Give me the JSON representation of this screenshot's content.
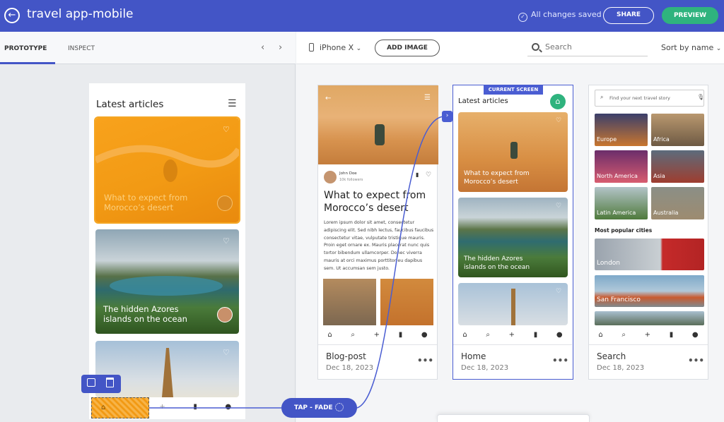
{
  "header": {
    "back_icon": "arrow-left-circle-icon",
    "title": "travel app-mobile",
    "status": "All changes saved",
    "share_label": "SHARE",
    "preview_label": "PREVIEW",
    "brand_color": "#4355c6",
    "preview_color": "#2fb37e"
  },
  "left_tabs": {
    "prototype": "PROTOTYPE",
    "inspect": "INSPECT",
    "prev": "‹",
    "next": "›"
  },
  "toolbar": {
    "device": "iPhone X",
    "add_image": "ADD IMAGE",
    "search_placeholder": "Search",
    "sort": "Sort by name"
  },
  "editor": {
    "title": "Latest articles",
    "cards": [
      {
        "text": "What to expect from Morocco’s desert"
      },
      {
        "text": "The hidden Azores islands on the ocean"
      },
      {
        "text": ""
      }
    ],
    "tools": [
      "copy-icon",
      "trash-icon"
    ],
    "link_label": "TAP - FADE"
  },
  "screens": [
    {
      "name": "Blog-post",
      "date": "Dec 18, 2023",
      "author": "John Doe",
      "followers": "10k followers",
      "headline": "What to expect from Morocco’s desert",
      "body": "Lorem ipsum dolor sit amet, consectetur adipiscing elit. Sed nibh lectus, faucibus faucibus consectetur vitae, vulputate tristique mauris. Proin eget ornare ex. Mauris placerat nunc quis tortor bibendum ullamcorper. Donec viverra mauris at orci maximus porttitor eu dapibus sem. Ut accumsan sem justo."
    },
    {
      "name": "Home",
      "date": "Dec 18, 2023",
      "badge": "CURRENT SCREEN",
      "title": "Latest articles",
      "cards": [
        "What to expect from Morocco’s desert",
        "The hidden Azores islands on the ocean"
      ]
    },
    {
      "name": "Search",
      "date": "Dec 18, 2023",
      "search_placeholder": "Find your next travel story",
      "regions": [
        "Europe",
        "Africa",
        "North America",
        "Asia",
        "Latin America",
        "Australia"
      ],
      "cities_title": "Most popular cities",
      "cities": [
        "London",
        "San Francisco"
      ]
    }
  ]
}
